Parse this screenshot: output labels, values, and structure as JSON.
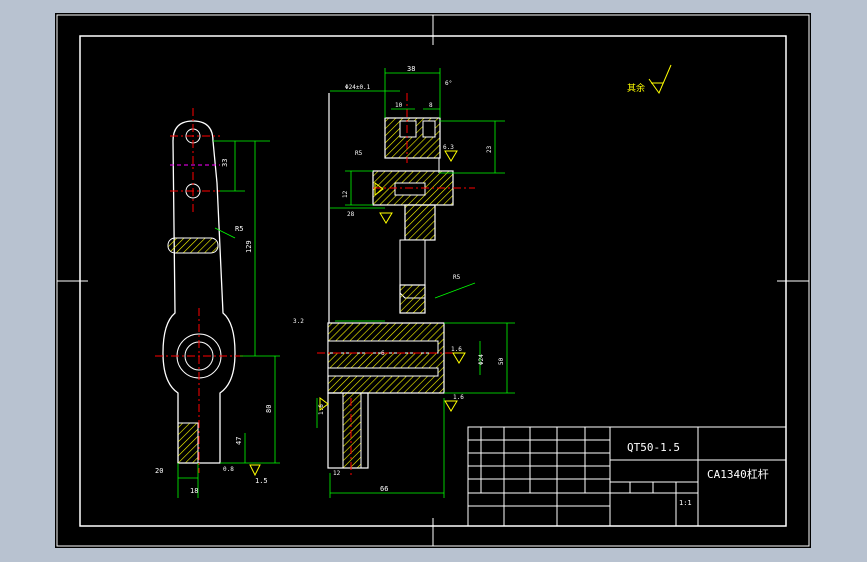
{
  "drawing": {
    "material": "QT50-1.5",
    "part_name": "CA1340杠杆",
    "scale": "1:1",
    "surface_note": "其余",
    "surface_symbol": "check-roughness-icon"
  },
  "dimensions": {
    "left_view": [
      "33",
      "R5",
      "129",
      "80",
      "47",
      "18",
      "20",
      "0.8",
      "1.5"
    ],
    "section_view": [
      "38",
      "Φ24±0.1",
      "10",
      "8",
      "6°",
      "R5",
      "6.3",
      "23",
      "12",
      "28",
      "R5",
      "1.6",
      "Φ24",
      "50",
      "1.6",
      "1.6",
      "3.2",
      "12",
      "6",
      "66"
    ]
  },
  "colors": {
    "outline": "#ffffff",
    "dimension": "#00ff00",
    "centerline": "#ff0000",
    "hatch": "#ffff00",
    "symbol": "#ffff00",
    "cutplane": "#ff00ff"
  }
}
